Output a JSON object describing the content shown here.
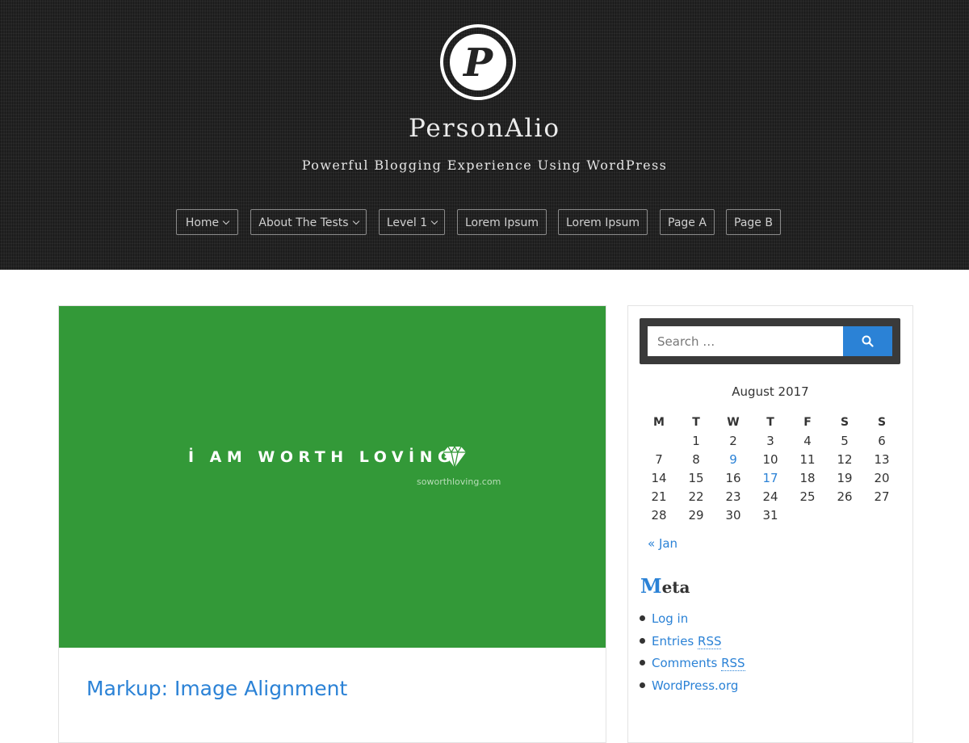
{
  "header": {
    "site_title": "PersonAlio",
    "tagline": "Powerful Blogging Experience Using WordPress",
    "logo_letter": "P"
  },
  "nav": {
    "items": [
      {
        "label": "Home",
        "has_dropdown": true
      },
      {
        "label": "About The Tests",
        "has_dropdown": true
      },
      {
        "label": "Level 1",
        "has_dropdown": true
      },
      {
        "label": "Lorem Ipsum",
        "has_dropdown": false
      },
      {
        "label": "Lorem Ipsum",
        "has_dropdown": false
      },
      {
        "label": "Page A",
        "has_dropdown": false
      },
      {
        "label": "Page B",
        "has_dropdown": false
      }
    ]
  },
  "post": {
    "featured_text": "İ AM WORTH LOVİNG",
    "featured_url": "soworthloving.com",
    "featured_bg": "#339938",
    "title": "Markup: Image Alignment"
  },
  "sidebar": {
    "search": {
      "placeholder": "Search …",
      "button_icon": "search-icon"
    },
    "calendar": {
      "caption": "August 2017",
      "weekdays": [
        "M",
        "T",
        "W",
        "T",
        "F",
        "S",
        "S"
      ],
      "weeks": [
        [
          "",
          "1",
          "2",
          "3",
          "4",
          "5",
          "6"
        ],
        [
          "7",
          "8",
          "9",
          "10",
          "11",
          "12",
          "13"
        ],
        [
          "14",
          "15",
          "16",
          "17",
          "18",
          "19",
          "20"
        ],
        [
          "21",
          "22",
          "23",
          "24",
          "25",
          "26",
          "27"
        ],
        [
          "28",
          "29",
          "30",
          "31",
          "",
          "",
          ""
        ]
      ],
      "linked_days": [
        "9",
        "17"
      ],
      "prev_link": "« Jan"
    },
    "meta": {
      "title_first": "M",
      "title_rest": "eta",
      "items": [
        {
          "text": "Log in",
          "abbr": ""
        },
        {
          "text": "Entries ",
          "abbr": "RSS"
        },
        {
          "text": "Comments ",
          "abbr": "RSS"
        },
        {
          "text": "WordPress.org",
          "abbr": ""
        }
      ]
    }
  },
  "colors": {
    "accent": "#2b82d6",
    "header_bg": "#232323",
    "search_bg": "#3a3a3a"
  }
}
